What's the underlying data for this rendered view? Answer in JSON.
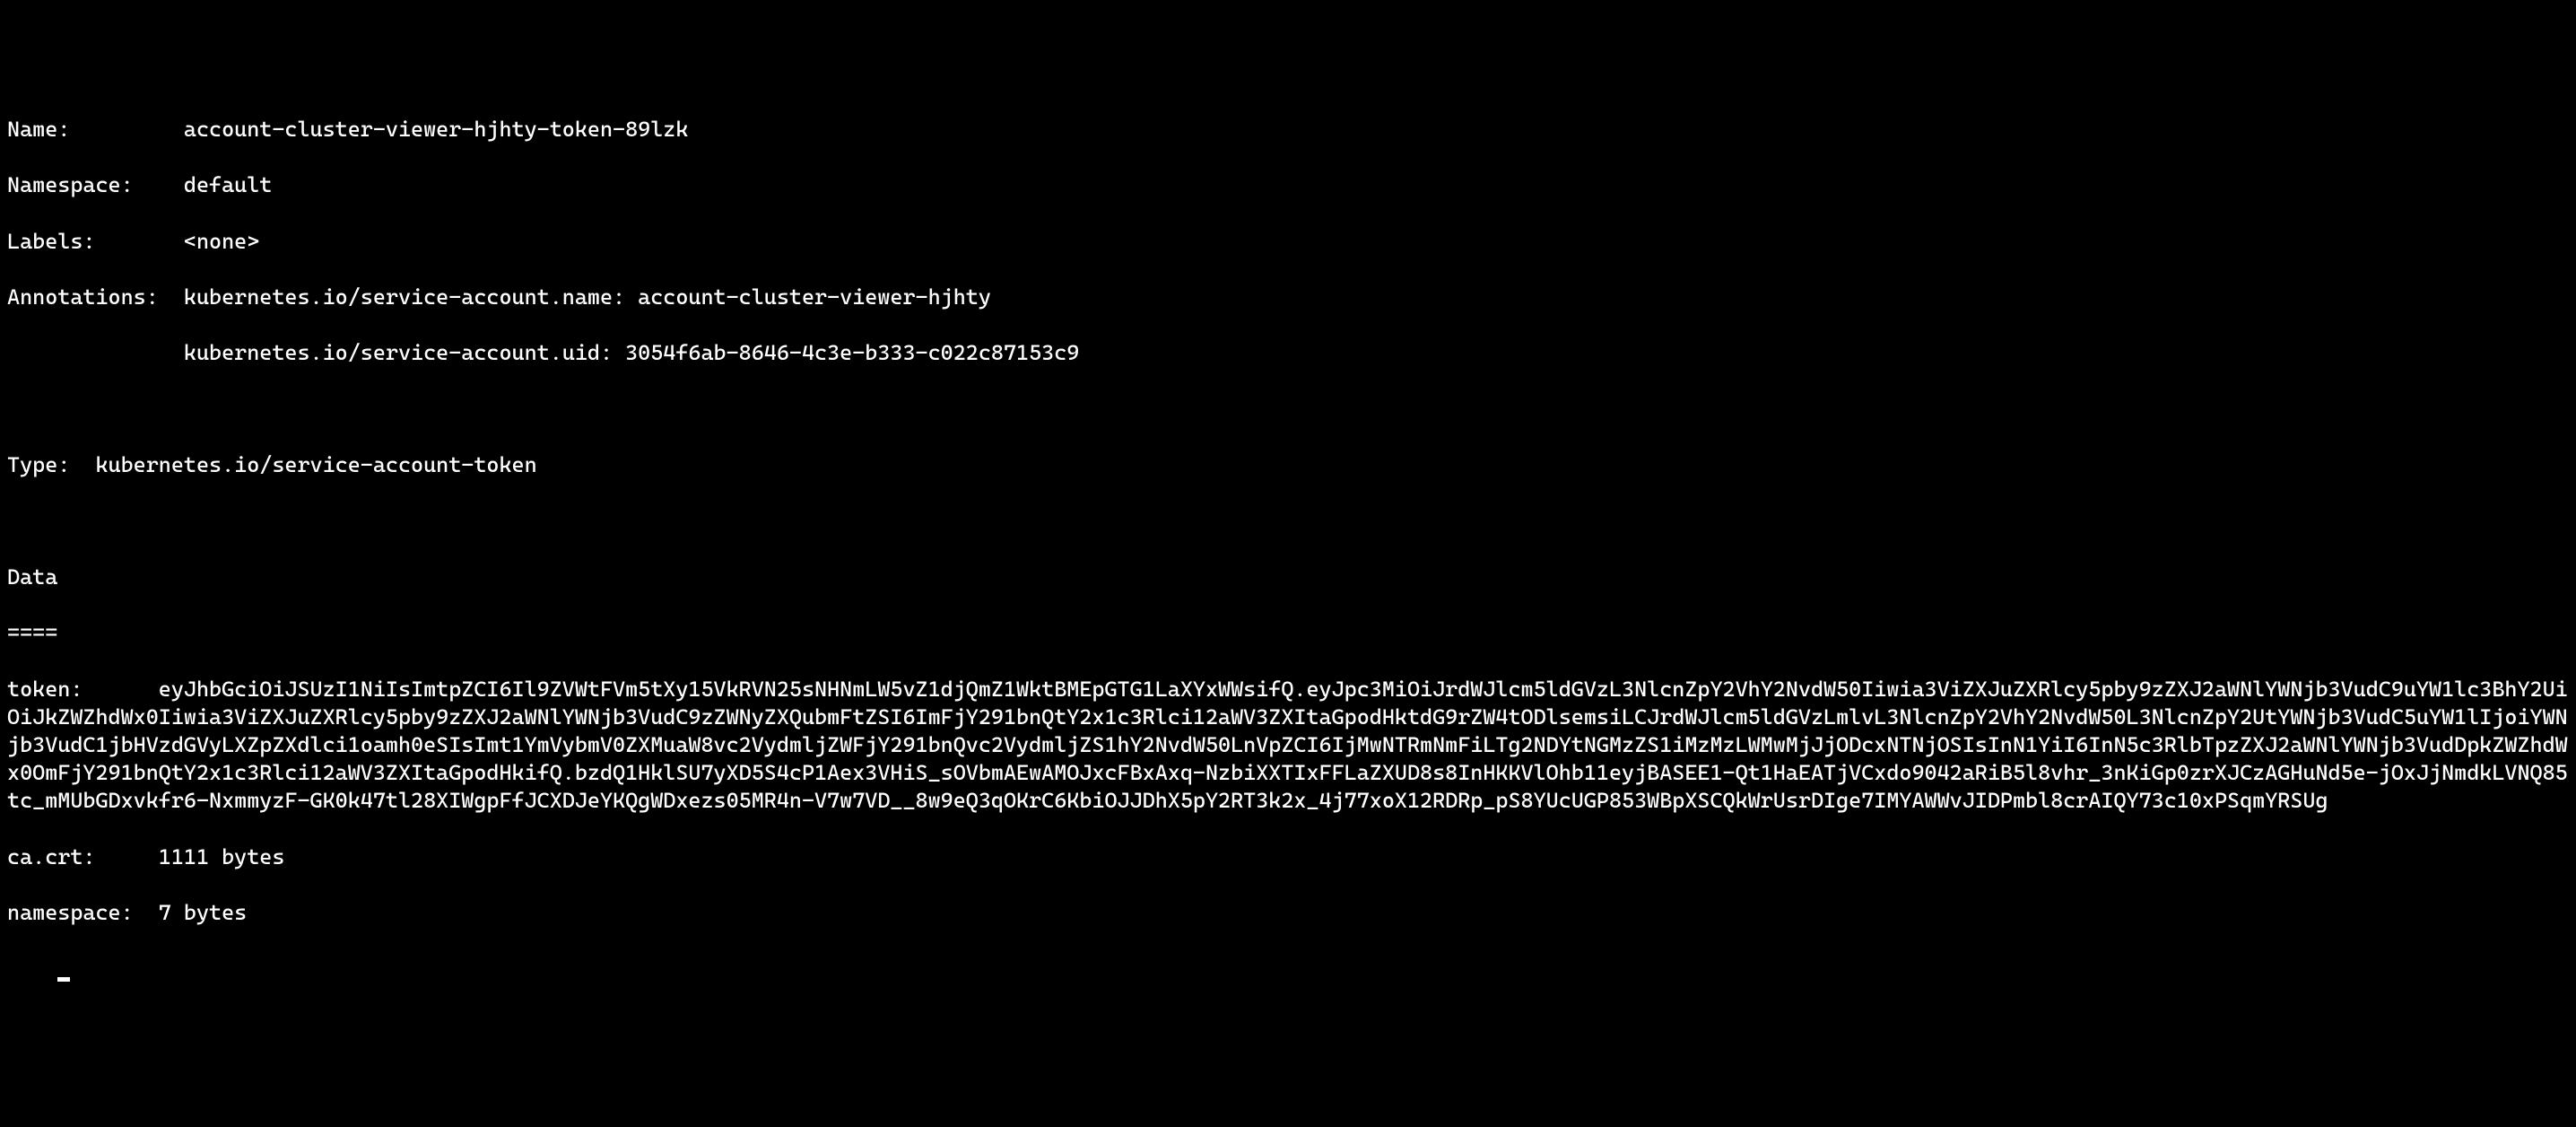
{
  "output": {
    "name_label": "Name:",
    "name_value": "account-cluster-viewer-hjhty-token-89lzk",
    "namespace_label": "Namespace:",
    "namespace_value": "default",
    "labels_label": "Labels:",
    "labels_value": "<none>",
    "annotations_label": "Annotations:",
    "annotations_value1": "kubernetes.io/service-account.name: account-cluster-viewer-hjhty",
    "annotations_value2": "kubernetes.io/service-account.uid: 3054f6ab-8646-4c3e-b333-c022c87153c9",
    "type_label": "Type:",
    "type_value": "kubernetes.io/service-account-token",
    "data_header": "Data",
    "data_divider": "====",
    "token_label": "token:",
    "token_value": "eyJhbGciOiJSUzI1NiIsImtpZCI6Il9ZVWtFVm5tXy15VkRVN25sNHNmLW5vZ1djQmZ1WktBMEpGTG1LaXYxWWsifQ.eyJpc3MiOiJrdWJlcm5ldGVzL3NlcnZpY2VhY2NvdW50Iiwia3ViZXJuZXRlcy5pby9zZXJ2aWNlYWNjb3VudC9uYW1lc3BhY2UiOiJkZWZhdWx0Iiwia3ViZXJuZXRlcy5pby9zZXJ2aWNlYWNjb3VudC9zZWNyZXQubmFtZSI6ImFjY291bnQtY2x1c3Rlci12aWV3ZXItaGpodHktdG9rZW4tODlsemsiLCJrdWJlcm5ldGVzLmlvL3NlcnZpY2VhY2NvdW50L3NlcnZpY2UtYWNjb3VudC5uYW1lIjoiYWNjb3VudC1jbHVzdGVyLXZpZXdlci1oamh0eSIsImt1YmVybmV0ZXMuaW8vc2VydmljZWFjY291bnQvc2VydmljZS1hY2NvdW50LnVpZCI6IjMwNTRmNmFiLTg2NDYtNGMzZS1iMzMzLWMwMjJjODcxNTNjOSIsInN1YiI6InN5c3RlbTpzZXJ2aWNlYWNjb3VudDpkZWZhdWx0OmFjY291bnQtY2x1c3Rlci12aWV3ZXItaGpodHkifQ.bzdQ1HklSU7yXD5S4cP1Aex3VHiS_sOVbmAEwAMOJxcFBxAxq-NzbiXXTIxFFLaZXUD8s8InHKKVlOhb11eyjBASEE1-Qt1HaEATjVCxdo9042aRiB5l8vhr_3nKiGp0zrXJCzAGHuNd5e-jOxJjNmdkLVNQ85tc_mMUbGDxvkfr6-NxmmyzF-GK0k47tl28XIWgpFfJCXDJeYKQgWDxezs05MR4n-V7w7VD__8w9eQ3qOKrC6KbiOJJDhX5pY2RT3k2x_4j77xoX12RDRp_pS8YUcUGP853WBpXSCQkWrUsrDIge7IMYAWWvJIDPmbl8crAIQY73c10xPSqmYRSUg",
    "ca_crt_label": "ca.crt:",
    "ca_crt_value": "1111 bytes",
    "ns_label": "namespace:",
    "ns_value": "7 bytes"
  }
}
